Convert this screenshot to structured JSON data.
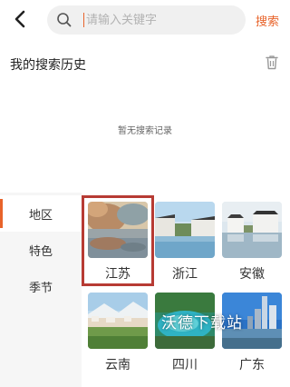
{
  "search": {
    "placeholder": "请输入关键字",
    "button_label": "搜索"
  },
  "history": {
    "title": "我的搜索历史",
    "empty_text": "暂无搜索记录"
  },
  "sidebar": {
    "items": [
      {
        "label": "地区",
        "active": true
      },
      {
        "label": "特色",
        "active": false
      },
      {
        "label": "季节",
        "active": false
      }
    ]
  },
  "regions": [
    {
      "label": "江苏",
      "selected": true
    },
    {
      "label": "浙江",
      "selected": false
    },
    {
      "label": "安徽",
      "selected": false
    },
    {
      "label": "云南",
      "selected": false
    },
    {
      "label": "四川",
      "selected": false
    },
    {
      "label": "广东",
      "selected": false
    }
  ],
  "watermark": "沃德下载站",
  "colors": {
    "accent": "#e8632a",
    "selection_border": "#b73b34"
  }
}
